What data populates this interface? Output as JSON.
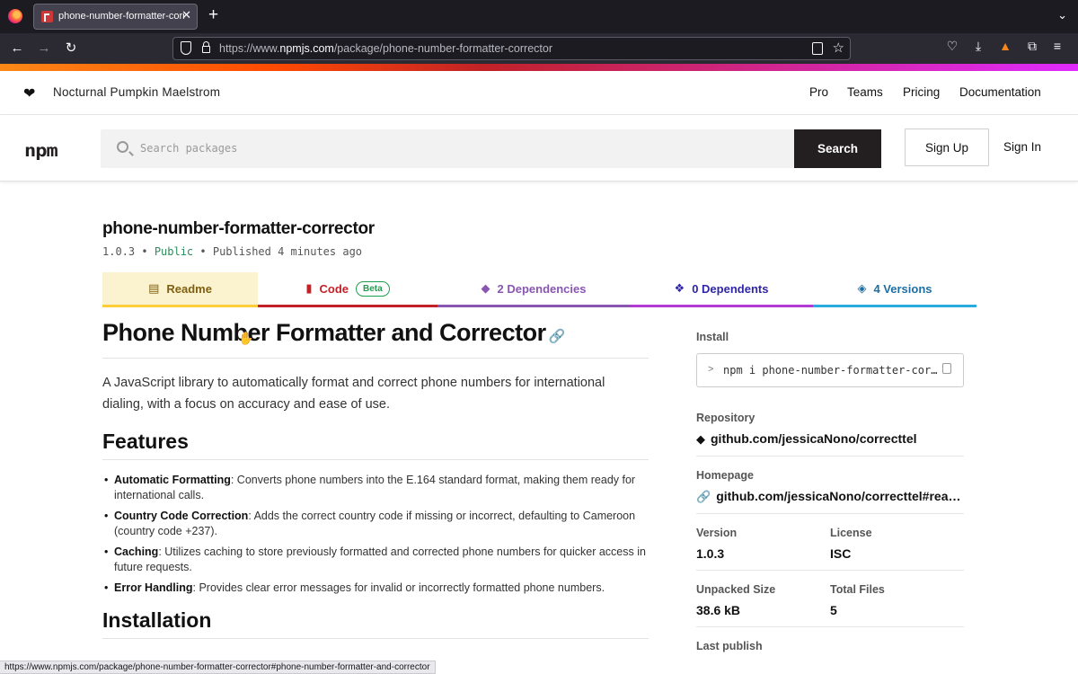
{
  "browser": {
    "tab_title": "phone-number-formatter-corrector",
    "url_prefix": "https://www.",
    "url_host": "npmjs.com",
    "url_path": "/package/phone-number-formatter-corrector",
    "status_url": "https://www.npmjs.com/package/phone-number-formatter-corrector#phone-number-formatter-and-corrector"
  },
  "topbar": {
    "org_name": "Nocturnal Pumpkin Maelstrom",
    "links": [
      "Pro",
      "Teams",
      "Pricing",
      "Documentation"
    ]
  },
  "searchbar": {
    "logo_text": "npm",
    "placeholder": "Search packages",
    "search_label": "Search",
    "signup_label": "Sign Up",
    "signin_label": "Sign In"
  },
  "package": {
    "name": "phone-number-formatter-corrector",
    "version": "1.0.3",
    "visibility": "Public",
    "published": "Published 4 minutes ago"
  },
  "tabs": {
    "readme": "Readme",
    "code": "Code",
    "beta": "Beta",
    "dependencies": "2 Dependencies",
    "dependents": "0 Dependents",
    "versions": "4 Versions"
  },
  "readme": {
    "title": "Phone Number Formatter and Corrector",
    "intro": "A JavaScript library to automatically format and correct phone numbers for international dialing, with a focus on accuracy and ease of use.",
    "features_heading": "Features",
    "features": [
      {
        "name": "Automatic Formatting",
        "text": ": Converts phone numbers into the E.164 standard format, making them ready for international calls."
      },
      {
        "name": "Country Code Correction",
        "text": ": Adds the correct country code if missing or incorrect, defaulting to Cameroon (country code +237)."
      },
      {
        "name": "Caching",
        "text": ": Utilizes caching to store previously formatted and corrected phone numbers for quicker access in future requests."
      },
      {
        "name": "Error Handling",
        "text": ": Provides clear error messages for invalid or incorrectly formatted phone numbers."
      }
    ],
    "installation_heading": "Installation"
  },
  "sidebar": {
    "install_label": "Install",
    "install_cmd": "npm i phone-number-formatter-corrector",
    "repository_label": "Repository",
    "repository": "github.com/jessicaNono/correcttel",
    "homepage_label": "Homepage",
    "homepage": "github.com/jessicaNono/correcttel#readme",
    "version_label": "Version",
    "version": "1.0.3",
    "license_label": "License",
    "license": "ISC",
    "unpacked_label": "Unpacked Size",
    "unpacked": "38.6 kB",
    "files_label": "Total Files",
    "files": "5",
    "last_publish_label": "Last publish"
  }
}
